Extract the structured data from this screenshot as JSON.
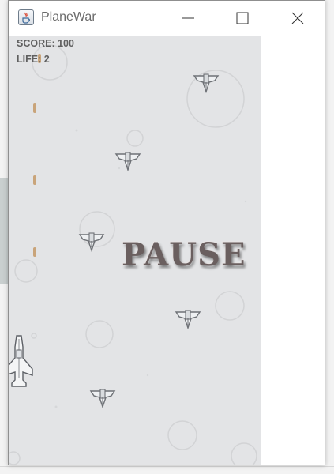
{
  "window": {
    "title": "PlaneWar",
    "controls": {
      "minimize": "minimize",
      "maximize": "maximize",
      "close": "close"
    }
  },
  "hud": {
    "score_text": "SCORE: 100",
    "life_text": "LIFE: 2"
  },
  "overlay": {
    "pause_text": "PAUSE"
  },
  "colors": {
    "game_background": "#e3e4e6",
    "hud_text": "#5f5f5f",
    "pause_text": "#6a5f5f",
    "bullet": "#c9a47a"
  },
  "icons": [
    "java-app-icon",
    "minimize-icon",
    "maximize-icon",
    "close-icon"
  ]
}
